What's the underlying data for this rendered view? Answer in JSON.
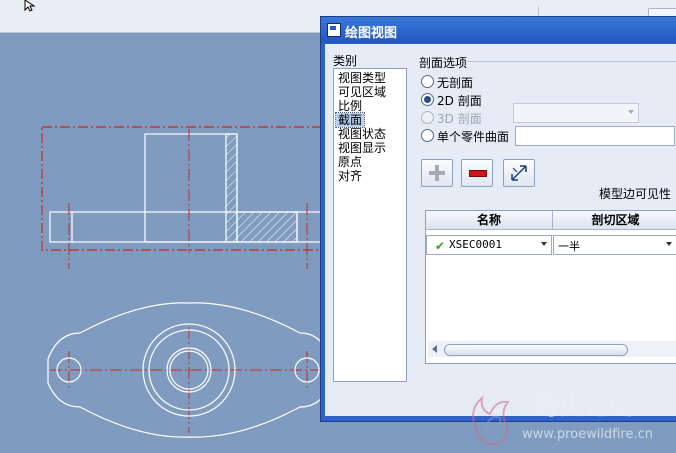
{
  "dialog": {
    "title": "绘图视图",
    "category_label": "类别",
    "categories": [
      "视图类型",
      "可见区域",
      "比例",
      "截面",
      "视图状态",
      "视图显示",
      "原点",
      "对齐"
    ],
    "selected_category": "截面",
    "section_options_label": "剖面选项",
    "radio": {
      "no_section": "无剖面",
      "section_2d": "2D 剖面",
      "section_3d": "3D 剖面",
      "single_part_surface": "单个零件曲面"
    },
    "selected_radio": "2D 剖面",
    "model_edge_visibility": "模型边可见性",
    "table": {
      "headers": [
        "名称",
        "剖切区域"
      ],
      "rows": [
        {
          "name": "XSEC0001",
          "region": "一半",
          "status": "ok"
        }
      ]
    }
  },
  "colors": {
    "viewport_bg": "#7f9bbf",
    "dialog_title": "#2f63c8",
    "line": "#ffffff",
    "centerline": "#c5281f"
  },
  "watermark": {
    "brand": "野火论坛",
    "url": "www.proewildfire.cn"
  }
}
